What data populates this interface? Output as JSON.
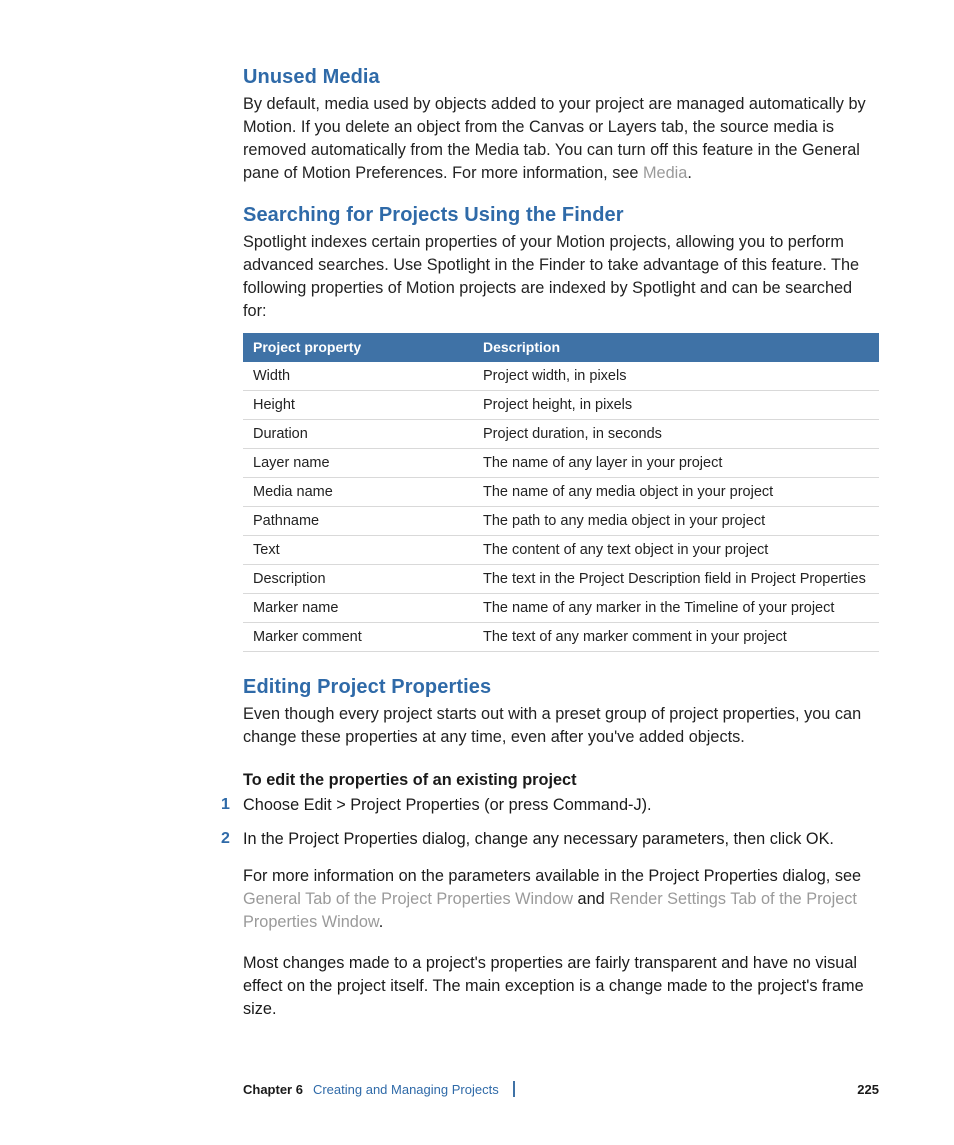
{
  "sections": {
    "unused_media": {
      "title": "Unused Media",
      "body_pre": "By default, media used by objects added to your project are managed automatically by Motion. If you delete an object from the Canvas or Layers tab, the source media is removed automatically from the Media tab. You can turn off this feature in the General pane of Motion Preferences. For more information, see ",
      "xref": "Media",
      "body_post": "."
    },
    "searching": {
      "title": "Searching for Projects Using the Finder",
      "body": "Spotlight indexes certain properties of your Motion projects, allowing you to perform advanced searches. Use Spotlight in the Finder to take advantage of this feature. The following properties of Motion projects are indexed by Spotlight and can be searched for:"
    },
    "editing": {
      "title": "Editing Project Properties",
      "intro": "Even though every project starts out with a preset group of project properties, you can change these properties at any time, even after you've added objects.",
      "task_head": "To edit the properties of an existing project",
      "steps": [
        "Choose Edit > Project Properties (or press Command-J).",
        "In the Project Properties dialog, change any necessary parameters, then click OK."
      ],
      "more_pre": "For more information on the parameters available in the Project Properties dialog, see ",
      "xref1": "General Tab of the Project Properties Window",
      "mid": " and ",
      "xref2": "Render Settings Tab of the Project Properties Window",
      "more_post": ".",
      "closing": "Most changes made to a project's properties are fairly transparent and have no visual effect on the project itself. The main exception is a change made to the project's frame size."
    }
  },
  "table": {
    "head": {
      "c0": "Project property",
      "c1": "Description"
    },
    "rows": [
      {
        "c0": "Width",
        "c1": "Project width, in pixels"
      },
      {
        "c0": "Height",
        "c1": "Project height, in pixels"
      },
      {
        "c0": "Duration",
        "c1": "Project duration, in seconds"
      },
      {
        "c0": "Layer name",
        "c1": "The name of any layer in your project"
      },
      {
        "c0": "Media name",
        "c1": "The name of any media object in your project"
      },
      {
        "c0": "Pathname",
        "c1": "The path to any media object in your project"
      },
      {
        "c0": "Text",
        "c1": "The content of any text object in your project"
      },
      {
        "c0": "Description",
        "c1": "The text in the Project Description field in Project Properties"
      },
      {
        "c0": "Marker name",
        "c1": "The name of any marker in the Timeline of your project"
      },
      {
        "c0": "Marker comment",
        "c1": "The text of any marker comment in your project"
      }
    ]
  },
  "footer": {
    "chapter_label": "Chapter 6",
    "chapter_title": "Creating and Managing Projects",
    "page": "225"
  }
}
